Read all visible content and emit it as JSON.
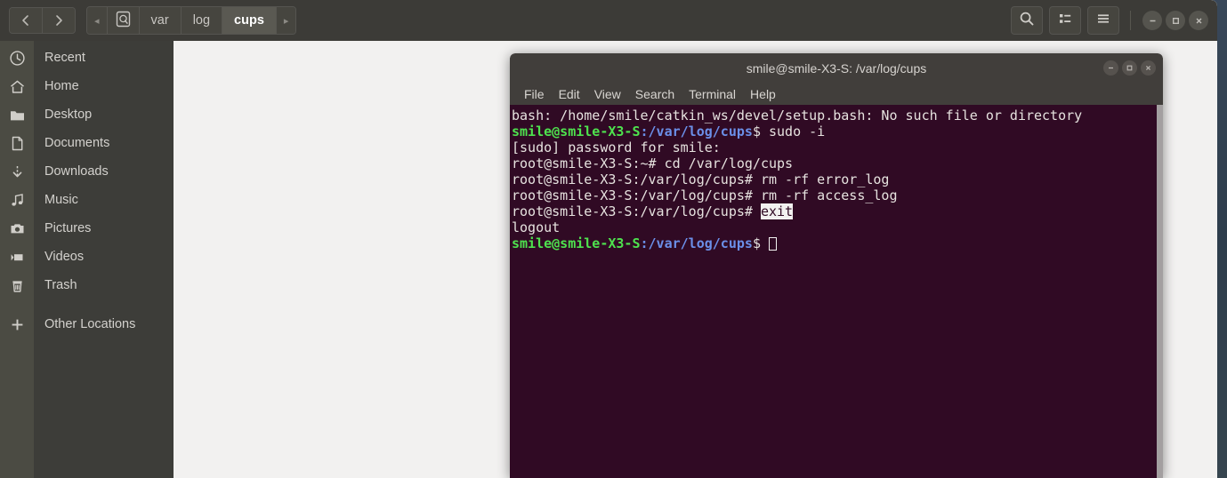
{
  "window": {
    "title": "smile@smile-X3-S: /var/log/cups"
  },
  "filemanager": {
    "nav": {
      "back_label": "‹",
      "forward_label": "›"
    },
    "breadcrumbs": {
      "left_arrow": "◂",
      "right_arrow": "▸",
      "root_icon": "filesystem-icon",
      "items": [
        {
          "label": "var",
          "active": false
        },
        {
          "label": "log",
          "active": false
        },
        {
          "label": "cups",
          "active": true
        }
      ]
    },
    "header_actions": [
      {
        "name": "search-icon",
        "label": "search"
      },
      {
        "name": "view-list-icon",
        "label": "view options"
      },
      {
        "name": "hamburger-menu-icon",
        "label": "menu"
      }
    ],
    "window_controls": [
      {
        "name": "minimize-button",
        "glyph": "−"
      },
      {
        "name": "maximize-button",
        "glyph": "□"
      },
      {
        "name": "close-button",
        "glyph": "×"
      }
    ],
    "sidebar": {
      "items": [
        {
          "label": "Recent",
          "icon": "clock-icon"
        },
        {
          "label": "Home",
          "icon": "home-icon"
        },
        {
          "label": "Desktop",
          "icon": "folder-icon"
        },
        {
          "label": "Documents",
          "icon": "document-icon"
        },
        {
          "label": "Downloads",
          "icon": "download-icon"
        },
        {
          "label": "Music",
          "icon": "music-note-icon"
        },
        {
          "label": "Pictures",
          "icon": "camera-icon"
        },
        {
          "label": "Videos",
          "icon": "video-icon"
        },
        {
          "label": "Trash",
          "icon": "trash-icon"
        }
      ],
      "other": {
        "label": "Other Locations",
        "icon": "plus-icon"
      }
    }
  },
  "terminal": {
    "title": "smile@smile-X3-S: /var/log/cups",
    "menus": [
      "File",
      "Edit",
      "View",
      "Search",
      "Terminal",
      "Help"
    ],
    "window_controls": [
      {
        "name": "terminal-minimize-button",
        "glyph": "−"
      },
      {
        "name": "terminal-maximize-button",
        "glyph": "□"
      },
      {
        "name": "terminal-close-button",
        "glyph": "×"
      }
    ],
    "lines": [
      {
        "plain": "bash: /home/smile/catkin_ws/devel/setup.bash: No such file or directory"
      },
      {
        "user": "smile@smile-X3-S",
        "path": ":/var/log/cups",
        "sigil": "$ ",
        "cmd": "sudo -i"
      },
      {
        "plain": "[sudo] password for smile:"
      },
      {
        "plain": "root@smile-X3-S:~# cd /var/log/cups"
      },
      {
        "plain": "root@smile-X3-S:/var/log/cups# rm -rf error_log"
      },
      {
        "plain": "root@smile-X3-S:/var/log/cups# rm -rf access_log"
      },
      {
        "plain": "root@smile-X3-S:/var/log/cups# ",
        "selected": "exit"
      },
      {
        "plain": "logout"
      },
      {
        "user": "smile@smile-X3-S",
        "path": ":/var/log/cups",
        "sigil": "$ ",
        "cmd": "",
        "cursor": true
      }
    ],
    "colors": {
      "background": "#300a24",
      "foreground": "#e6e2df",
      "prompt_user": "#4ee24e",
      "prompt_path": "#6b8fe8",
      "selection_bg": "#f2f1f0"
    }
  }
}
